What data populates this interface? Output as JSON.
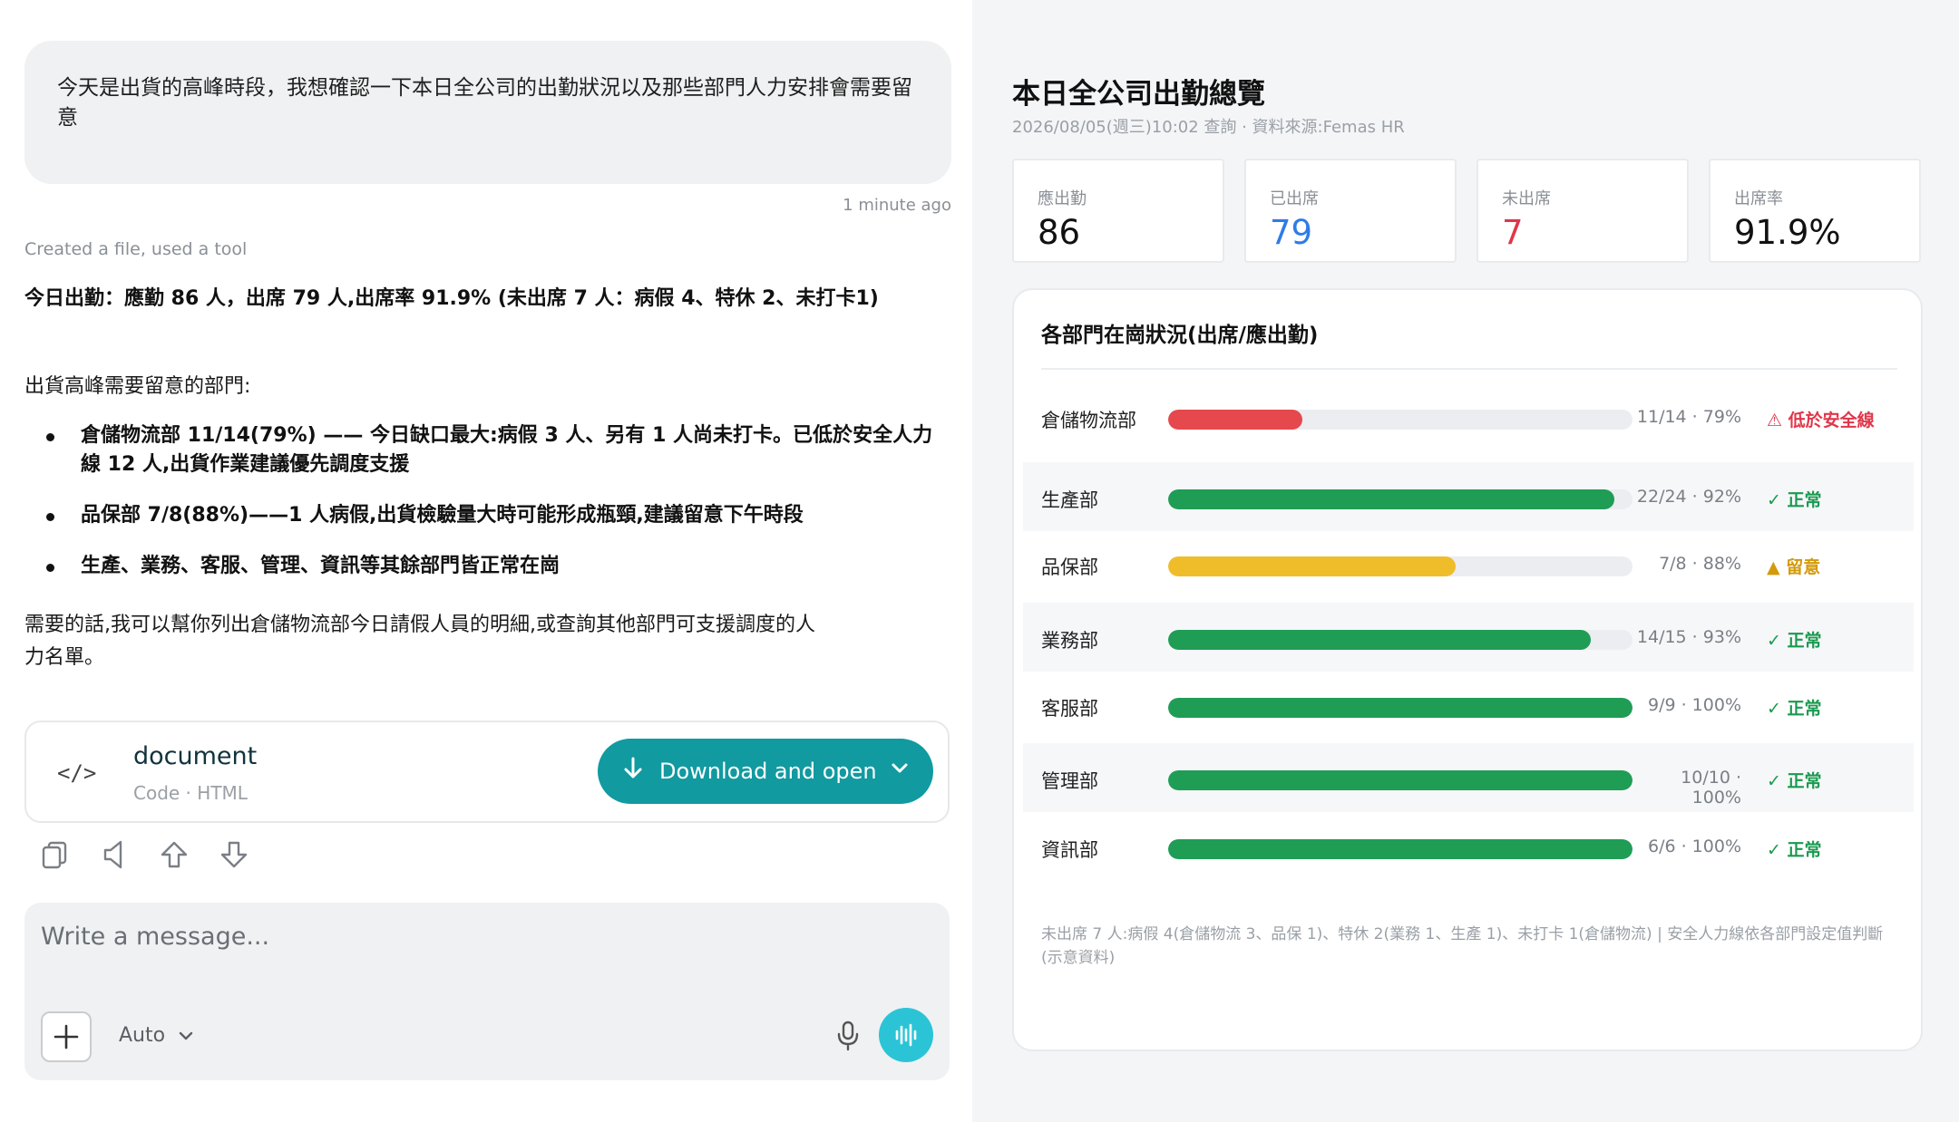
{
  "chat": {
    "user_message": "今天是出貨的高峰時段，我想確認一下本日全公司的出勤狀況以及那些部門人力安排會需要留意",
    "message_time": "1 minute ago",
    "tool_note": "Created a file, used a tool",
    "summary": "今日出勤：應勤 86 人，出席 79 人,出席率 91.9% (未出席 7 人：病假 4、特休 2、未打卡1)",
    "intro": "出貨高峰需要留意的部門:",
    "bullets": [
      "倉儲物流部 11/14(79%) —— 今日缺口最大:病假 3 人、另有 1 人尚未打卡。已低於安全人力線 12 人,出貨作業建議優先調度支援",
      "品保部 7/8(88%)——1 人病假,出貨檢驗量大時可能形成瓶頸,建議留意下午時段",
      "生產、業務、客服、管理、資訊等其餘部門皆正常在崗"
    ],
    "closing": "需要的話,我可以幫你列出倉儲物流部今日請假人員的明細,或查詢其他部門可支援調度的人力名單。"
  },
  "file_card": {
    "icon": "code-icon",
    "name": "document",
    "meta": "Code · HTML",
    "download_label": "Download and open"
  },
  "message_actions": [
    "copy-icon",
    "speaker-icon",
    "thumbs-up-icon",
    "thumbs-down-icon"
  ],
  "composer": {
    "placeholder": "Write a message...",
    "mode": "Auto"
  },
  "dashboard": {
    "title": "本日全公司出勤總覽",
    "subtitle": "2026/08/05(週三)10:02 查詢 · 資料來源:Femas HR",
    "stats": [
      {
        "label": "應出勤",
        "value": "86",
        "color": "#111111"
      },
      {
        "label": "已出席",
        "value": "79",
        "color": "#2f7be8"
      },
      {
        "label": "未出席",
        "value": "7",
        "color": "#e0364a"
      },
      {
        "label": "出席率",
        "value": "91.9%",
        "color": "#111111"
      }
    ],
    "dept_title": "各部門在崗狀況(出席/應出勤)",
    "departments": [
      {
        "name": "倉儲物流部",
        "ratio": "11/14 · 79%",
        "fill": 0.29,
        "bar_color": "#e5484d",
        "status": "⚠ 低於安全線",
        "status_type": "danger"
      },
      {
        "name": "生產部",
        "ratio": "22/24 · 92%",
        "fill": 0.96,
        "bar_color": "#1f9d55",
        "status": "✓ 正常",
        "status_type": "ok"
      },
      {
        "name": "品保部",
        "ratio": "7/8 · 88%",
        "fill": 0.62,
        "bar_color": "#f0bd2a",
        "status": "▲ 留意",
        "status_type": "warn"
      },
      {
        "name": "業務部",
        "ratio": "14/15 · 93%",
        "fill": 0.91,
        "bar_color": "#1f9d55",
        "status": "✓ 正常",
        "status_type": "ok"
      },
      {
        "name": "客服部",
        "ratio": "9/9 · 100%",
        "fill": 1.0,
        "bar_color": "#1f9d55",
        "status": "✓ 正常",
        "status_type": "ok"
      },
      {
        "name": "管理部",
        "ratio": "10/10 · 100%",
        "fill": 1.0,
        "bar_color": "#1f9d55",
        "status": "✓ 正常",
        "status_type": "ok"
      },
      {
        "name": "資訊部",
        "ratio": "6/6 · 100%",
        "fill": 1.0,
        "bar_color": "#1f9d55",
        "status": "✓ 正常",
        "status_type": "ok"
      }
    ],
    "footnote": "未出席 7 人:病假 4(倉儲物流 3、品保 1)、特休 2(業務 1、生產 1)、未打卡 1(倉儲物流) | 安全人力線依各部門設定值判斷(示意資料)"
  }
}
